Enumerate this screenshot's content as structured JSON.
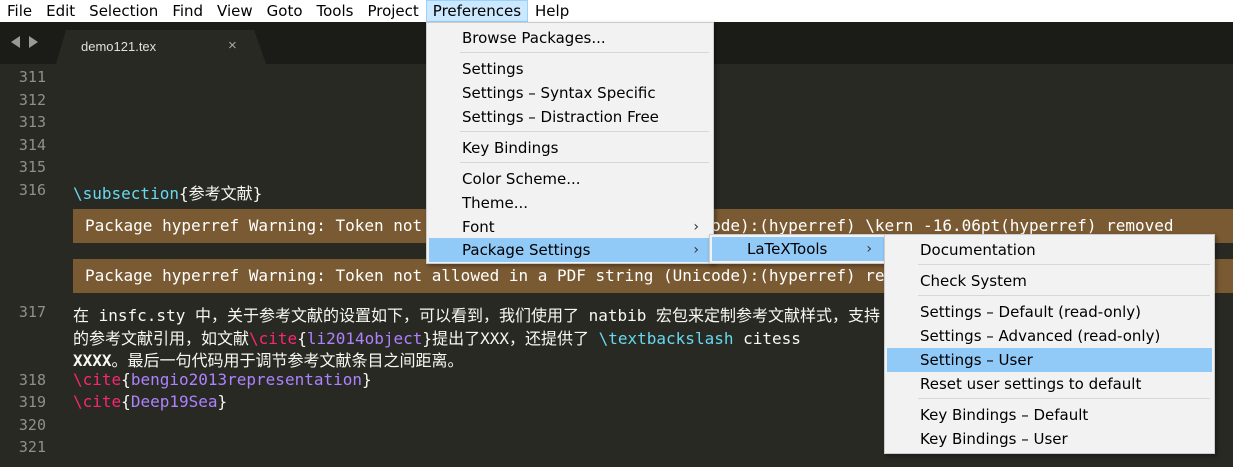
{
  "menubar": {
    "items": [
      "File",
      "Edit",
      "Selection",
      "Find",
      "View",
      "Goto",
      "Tools",
      "Project",
      "Preferences",
      "Help"
    ]
  },
  "tab": {
    "title": "demo121.tex",
    "close_glyph": "×"
  },
  "editor": {
    "line_numbers": [
      "311",
      "312",
      "313",
      "314",
      "315",
      "316",
      "317",
      "318",
      "319",
      "320",
      "321"
    ],
    "l316_cmd": "\\subsection",
    "l316_arg": "{参考文献}",
    "warning_1": "Package hyperref Warning: Token not allowed in a PDF string (Unicode):(hyperref) \\kern -16.06pt(hyperref) removed",
    "warning_2": "Package hyperref Warning: Token not allowed in a PDF string (Unicode):(hyperref) removing `math shift' on input line",
    "l317_a": "在 insfc.sty 中，关于参考文献的设置如下，可以看到，我们使用了 natbib 宏包来定制参考文献样式，支持",
    "l317_b1": "的参考文献引用，如文献",
    "l317_b_cite": "\\cite",
    "l317_b_open": "{",
    "l317_b_arg": "li2014object",
    "l317_b_close": "}",
    "l317_b2": "提出了XXX，还提供了 ",
    "l317_b_kw": "\\textbackslash",
    "l317_b3": " citess",
    "l317_c_bold": "XXXX",
    "l317_c_rest": "。最后一句代码用于调节参考文献条目之间距离。",
    "l318_cite": "\\cite",
    "l318_arg": "bengio2013representation",
    "l319_cite": "\\cite",
    "l319_arg": "Deep19Sea",
    "open_brace": "{",
    "close_brace": "}"
  },
  "preferences_menu": {
    "items": [
      "Browse Packages...",
      "Settings",
      "Settings – Syntax Specific",
      "Settings – Distraction Free",
      "Key Bindings",
      "Color Scheme...",
      "Theme...",
      "Font",
      "Package Settings"
    ],
    "submenu_arrow": "›"
  },
  "package_settings_menu": {
    "items": [
      "LaTeXTools"
    ]
  },
  "latextools_menu": {
    "items": [
      "Documentation",
      "Check System",
      "Settings – Default (read-only)",
      "Settings – Advanced (read-only)",
      "Settings – User",
      "Reset user settings to default",
      "Key Bindings – Default",
      "Key Bindings – User"
    ]
  },
  "colors": {
    "editor_bg": "#282923",
    "menu_bg": "#f2f2f2",
    "menu_highlight": "#91c9f7",
    "warning_bg": "#7a5a32",
    "keyword": "#66d9ef",
    "cite": "#f92672",
    "arg": "#ae81ff"
  }
}
